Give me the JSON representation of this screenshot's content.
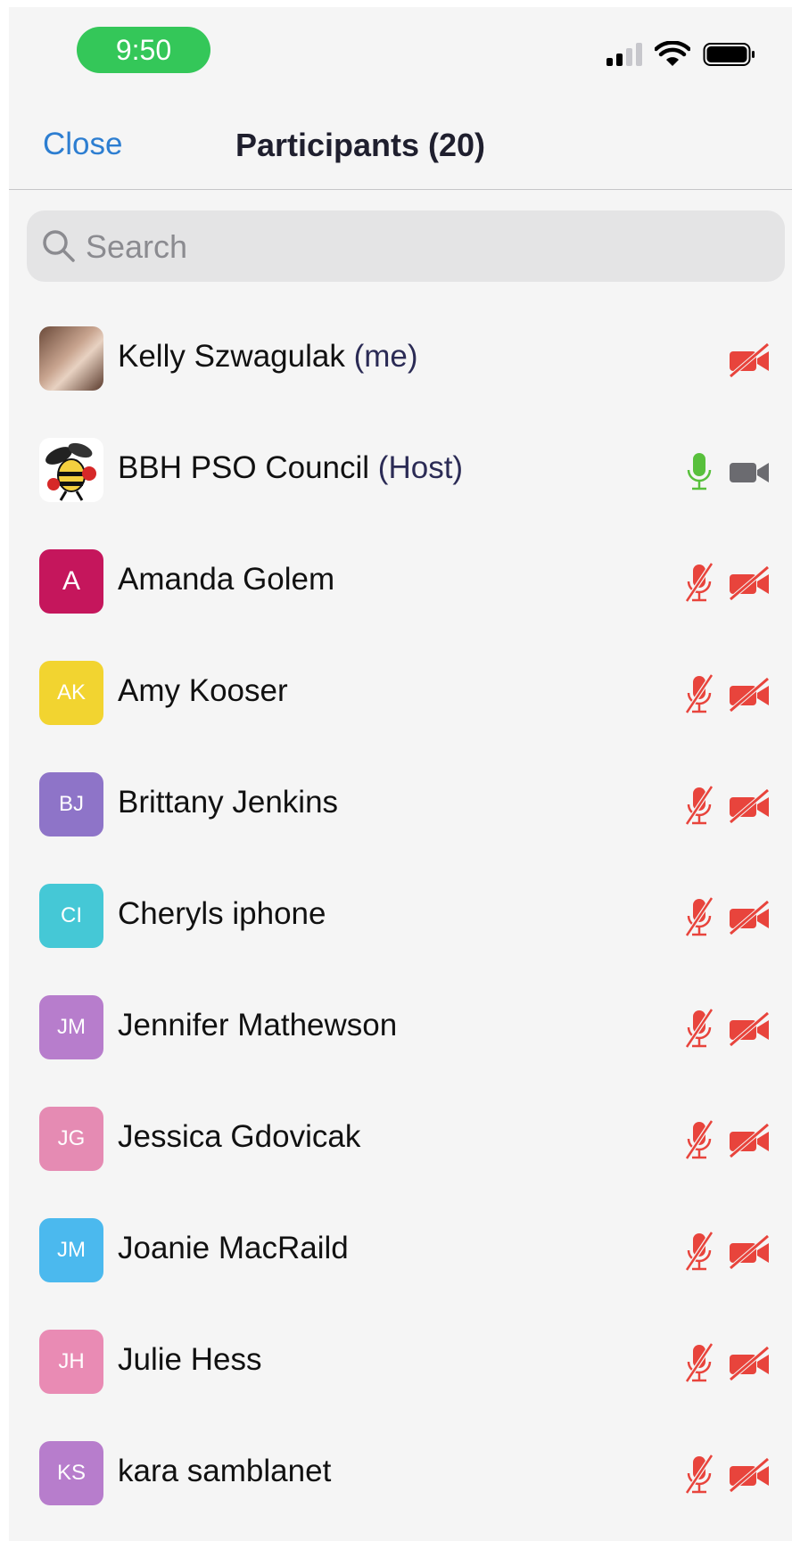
{
  "status_bar": {
    "time": "9:50"
  },
  "header": {
    "close_label": "Close",
    "title": "Participants (20)"
  },
  "search": {
    "placeholder": "Search"
  },
  "participants": [
    {
      "name": "Kelly Szwagulak",
      "tag": "(me)",
      "avatar": "photo",
      "initials": "",
      "color": "",
      "mic": "none",
      "video": "off"
    },
    {
      "name": "BBH PSO Council",
      "tag": "(Host)",
      "avatar": "logo",
      "initials": "",
      "color": "",
      "mic": "on",
      "video": "on"
    },
    {
      "name": "Amanda Golem",
      "tag": "",
      "avatar": "initials",
      "initials": "A",
      "color": "#c5165c",
      "mic": "muted",
      "video": "off"
    },
    {
      "name": "Amy Kooser",
      "tag": "",
      "avatar": "initials",
      "initials": "AK",
      "color": "#f2d430",
      "mic": "muted",
      "video": "off"
    },
    {
      "name": "Brittany Jenkins",
      "tag": "",
      "avatar": "initials",
      "initials": "BJ",
      "color": "#8e74c8",
      "mic": "muted",
      "video": "off"
    },
    {
      "name": "Cheryls iphone",
      "tag": "",
      "avatar": "initials",
      "initials": "CI",
      "color": "#45c8d6",
      "mic": "muted",
      "video": "off"
    },
    {
      "name": "Jennifer Mathewson",
      "tag": "",
      "avatar": "initials",
      "initials": "JM",
      "color": "#b77dcc",
      "mic": "muted",
      "video": "off"
    },
    {
      "name": "Jessica Gdovicak",
      "tag": "",
      "avatar": "initials",
      "initials": "JG",
      "color": "#e58bb3",
      "mic": "muted",
      "video": "off"
    },
    {
      "name": "Joanie MacRaild",
      "tag": "",
      "avatar": "initials",
      "initials": "JM",
      "color": "#4bb9ee",
      "mic": "muted",
      "video": "off"
    },
    {
      "name": "Julie Hess",
      "tag": "",
      "avatar": "initials",
      "initials": "JH",
      "color": "#e98bb4",
      "mic": "muted",
      "video": "off"
    },
    {
      "name": "kara samblanet",
      "tag": "",
      "avatar": "initials",
      "initials": "KS",
      "color": "#b77dcc",
      "mic": "muted",
      "video": "off"
    }
  ],
  "colors": {
    "accent": "#2d7ed1",
    "muted_red": "#e8443c",
    "mic_on_green": "#58c03c",
    "video_on_gray": "#6b6b70"
  }
}
